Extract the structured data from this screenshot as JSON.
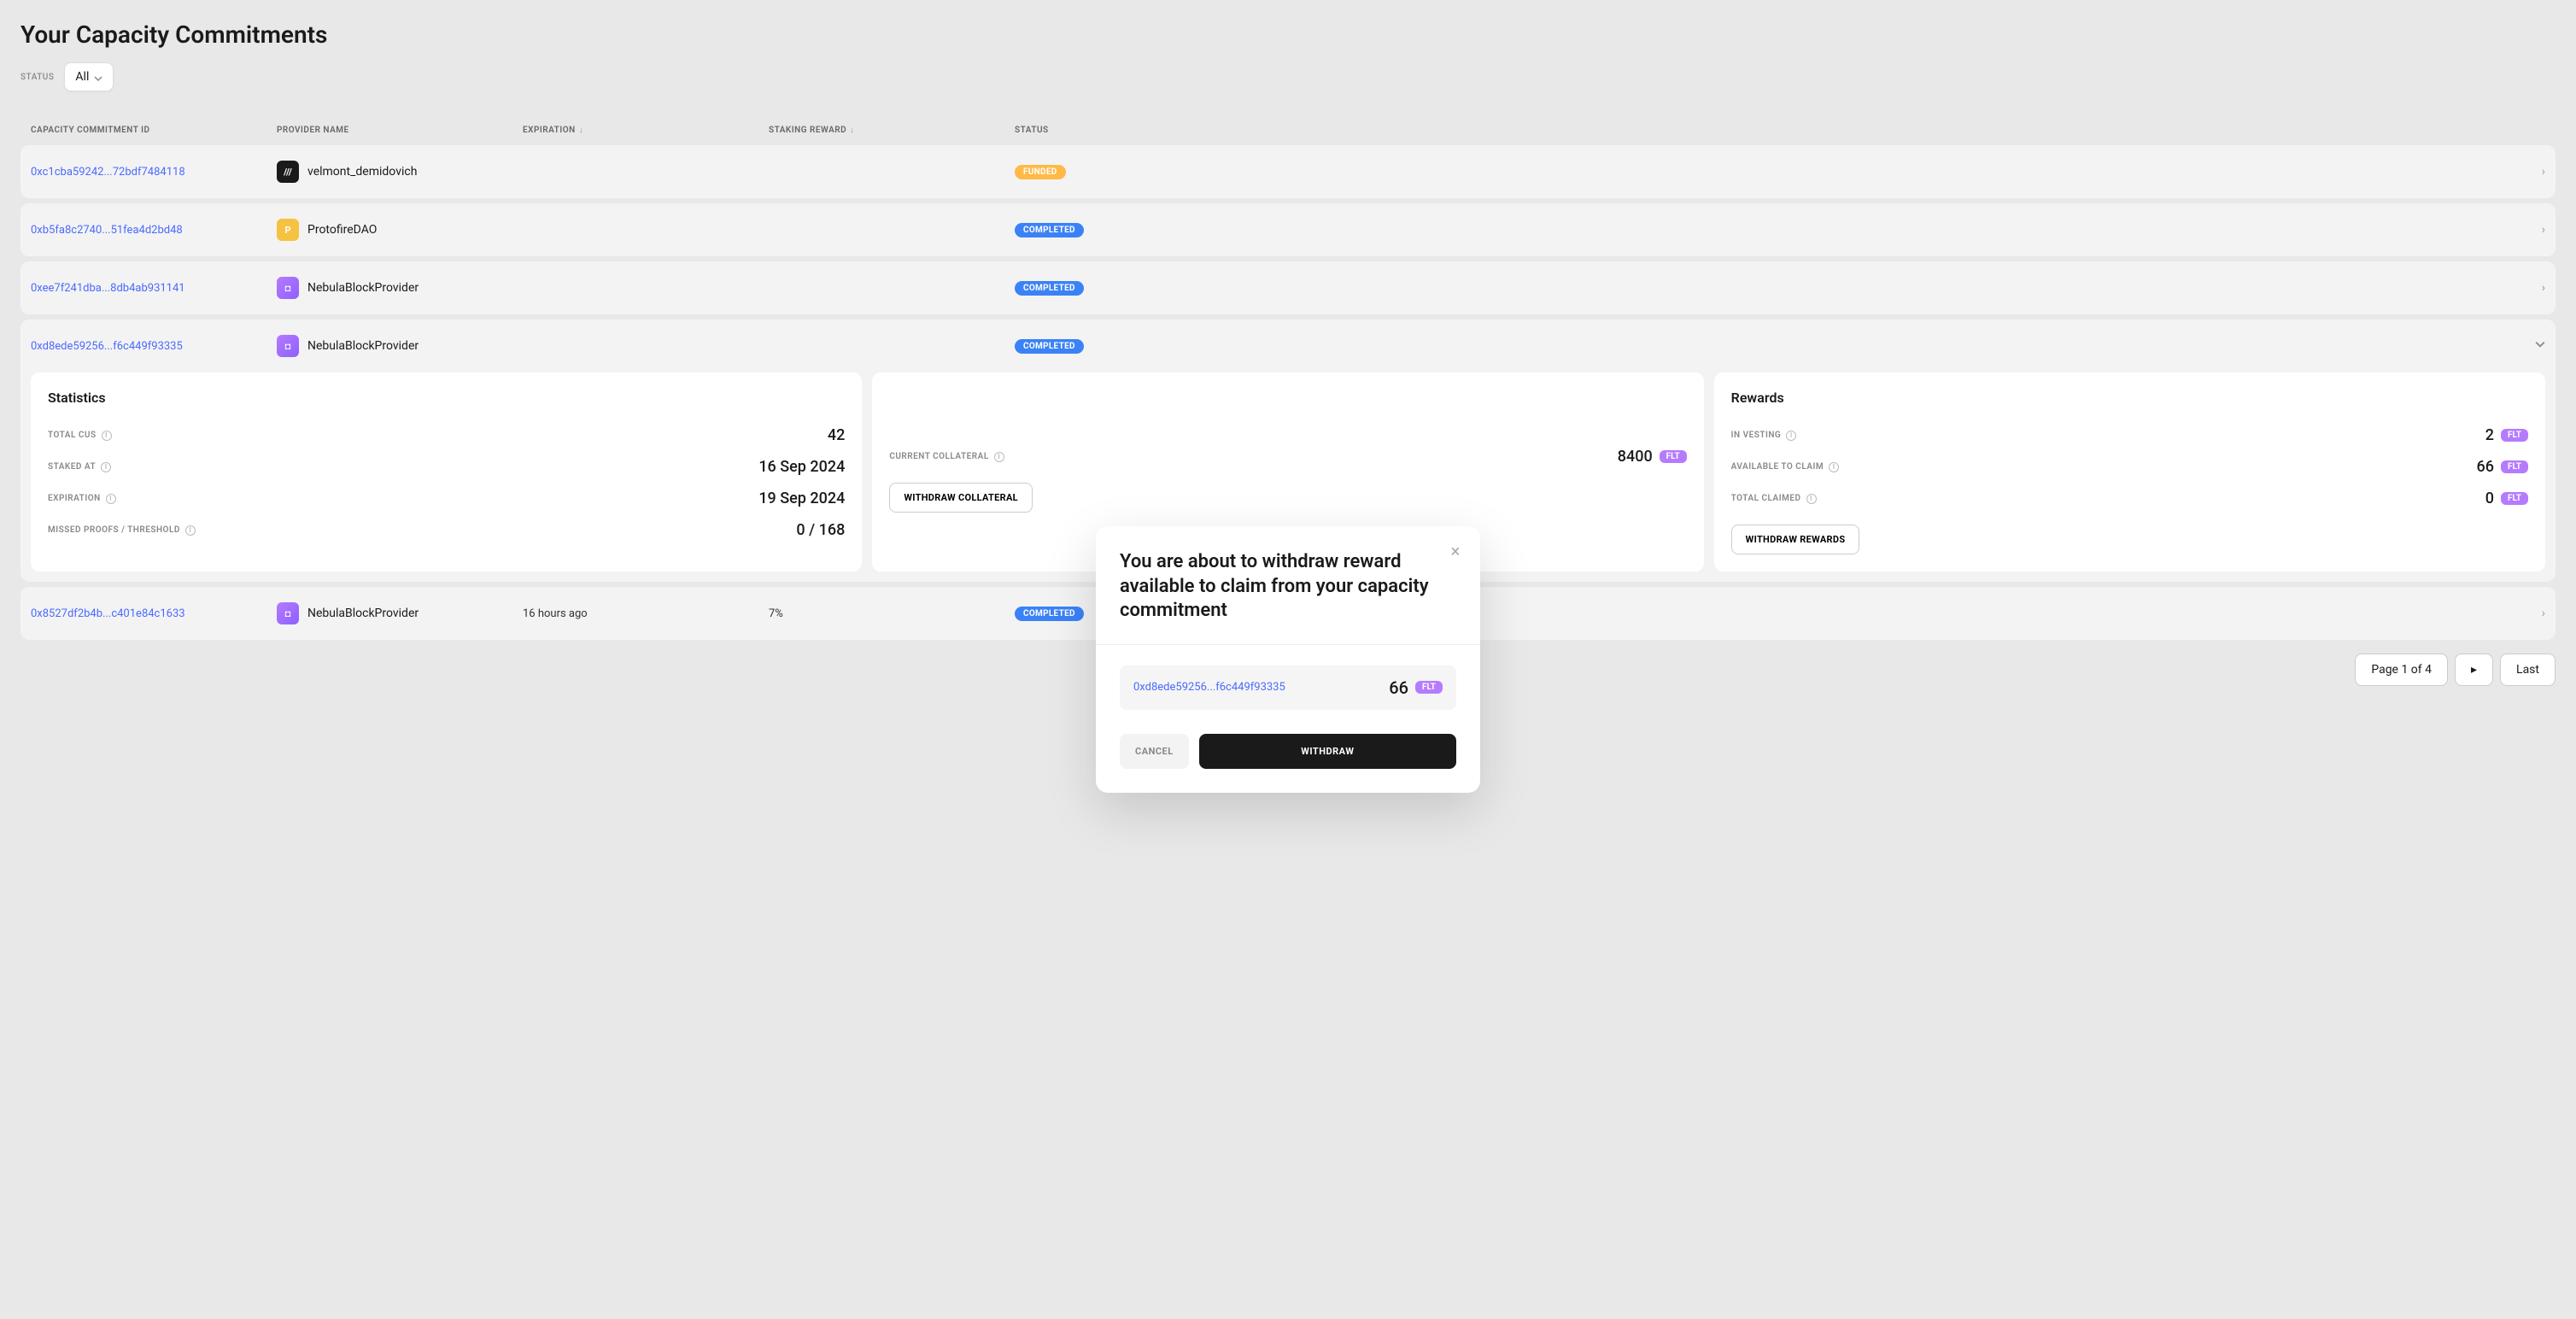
{
  "page_title": "Your Capacity Commitments",
  "filter": {
    "label": "STATUS",
    "value": "All"
  },
  "columns": {
    "id": "CAPACITY COMMITMENT ID",
    "provider": "PROVIDER NAME",
    "expiration": "EXPIRATION",
    "reward": "STAKING REWARD",
    "status": "STATUS"
  },
  "rows": [
    {
      "id": "0xc1cba59242...72bdf7484118",
      "provider": "velmont_demidovich",
      "icon": "black",
      "glyph": "///",
      "expiration": "",
      "reward": "",
      "status": "FUNDED"
    },
    {
      "id": "0xb5fa8c2740...51fea4d2bd48",
      "provider": "ProtofireDAO",
      "icon": "yellow",
      "glyph": "P",
      "expiration": "",
      "reward": "",
      "status": "COMPLETED"
    },
    {
      "id": "0xee7f241dba...8db4ab931141",
      "provider": "NebulaBlockProvider",
      "icon": "purple",
      "glyph": "◘",
      "expiration": "",
      "reward": "",
      "status": "COMPLETED"
    },
    {
      "id": "0xd8ede59256...f6c449f93335",
      "provider": "NebulaBlockProvider",
      "icon": "purple",
      "glyph": "◘",
      "expiration": "",
      "reward": "",
      "status": "COMPLETED",
      "expanded": true
    },
    {
      "id": "0x8527df2b4b...c401e84c1633",
      "provider": "NebulaBlockProvider",
      "icon": "purple",
      "glyph": "◘",
      "expiration": "16 hours ago",
      "reward": "7%",
      "status": "COMPLETED"
    }
  ],
  "statistics": {
    "title": "Statistics",
    "total_cus_label": "TOTAL CUS",
    "total_cus": "42",
    "staked_at_label": "STAKED AT",
    "staked_at": "16 Sep 2024",
    "expiration_label": "EXPIRATION",
    "expiration": "19 Sep 2024",
    "missed_label": "MISSED PROOFS / THRESHOLD",
    "missed": "0 / 168"
  },
  "collateral": {
    "current_label": "CURRENT COLLATERAL",
    "current": "8400",
    "token": "FLT",
    "withdraw_btn": "WITHDRAW COLLATERAL"
  },
  "rewards": {
    "title": "Rewards",
    "vesting_label": "IN VESTING",
    "vesting": "2",
    "claim_label": "AVAILABLE TO CLAIM",
    "claim": "66",
    "total_label": "TOTAL CLAIMED",
    "total": "0",
    "token": "FLT",
    "withdraw_btn": "WITHDRAW REWARDS"
  },
  "pagination": {
    "text": "Page 1 of 4",
    "last": "Last"
  },
  "modal": {
    "title": "You are about to withdraw reward available to claim from your capacity commitment",
    "id": "0xd8ede59256...f6c449f93335",
    "amount": "66",
    "token": "FLT",
    "cancel": "CANCEL",
    "confirm": "WITHDRAW"
  }
}
